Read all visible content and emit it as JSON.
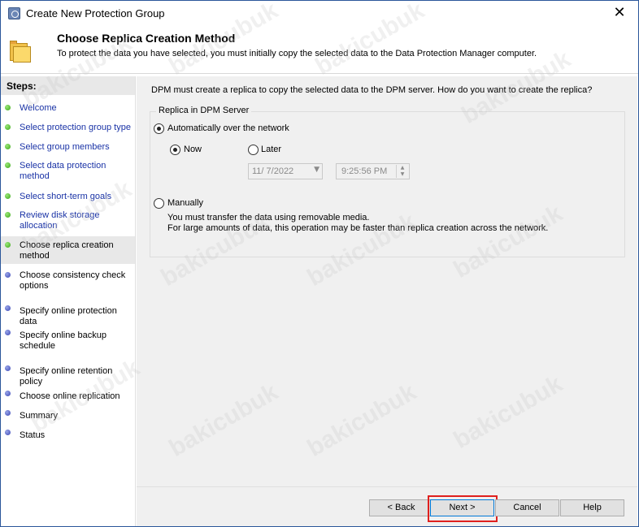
{
  "window": {
    "title": "Create New Protection Group"
  },
  "header": {
    "title": "Choose Replica Creation Method",
    "description": "To protect the data you have selected, you must initially copy the selected data to the Data Protection Manager computer."
  },
  "steps": {
    "title": "Steps:",
    "items": [
      {
        "label_1": "Welcome",
        "label_2": "",
        "status": "completed"
      },
      {
        "label_1": "Select protection group type",
        "label_2": "",
        "status": "completed"
      },
      {
        "label_1": "Select group members",
        "label_2": "",
        "status": "completed"
      },
      {
        "label_1": "Select data protection",
        "label_2": "method",
        "status": "completed"
      },
      {
        "label_1": "Select short-term goals",
        "label_2": "",
        "status": "completed"
      },
      {
        "label_1": "Review disk storage",
        "label_2": "allocation",
        "status": "completed"
      },
      {
        "label_1": "Choose replica creation",
        "label_2": "method",
        "status": "current"
      },
      {
        "label_1": "Choose consistency check",
        "label_2": "options",
        "status": "pending"
      },
      {
        "label_1": "Specify online protection data",
        "label_2": "",
        "status": "pending"
      },
      {
        "label_1": "Specify online backup",
        "label_2": "schedule",
        "status": "pending"
      },
      {
        "label_1": "Specify online retention policy",
        "label_2": "",
        "status": "pending"
      },
      {
        "label_1": "Choose online replication",
        "label_2": "",
        "status": "pending"
      },
      {
        "label_1": "Summary",
        "label_2": "",
        "status": "pending"
      },
      {
        "label_1": "Status",
        "label_2": "",
        "status": "pending"
      }
    ]
  },
  "content": {
    "question": "DPM must create a replica to copy the selected data to the DPM server. How do you want to create the replica?",
    "group_title": "Replica in DPM Server",
    "auto_option": {
      "label": "Automatically over the network",
      "checked": true
    },
    "now_option": {
      "label": "Now",
      "checked": true
    },
    "later_option": {
      "label": "Later",
      "checked": false
    },
    "date_value": "11/  7/2022",
    "time_value": "9:25:56 PM",
    "manual_option": {
      "label": "Manually",
      "checked": false
    },
    "manual_desc_1": "You must transfer the data using removable media.",
    "manual_desc_2": "For large amounts of data, this operation may be faster than replica creation across the network."
  },
  "buttons": {
    "back": "< Back",
    "next": "Next >",
    "cancel": "Cancel",
    "help": "Help"
  },
  "watermark": "bakicubuk",
  "colors": {
    "completed_dot": "#3aa515",
    "pending_dot": "#3844b5",
    "link_text": "#1a33a6",
    "highlight_border": "#e0201e"
  }
}
